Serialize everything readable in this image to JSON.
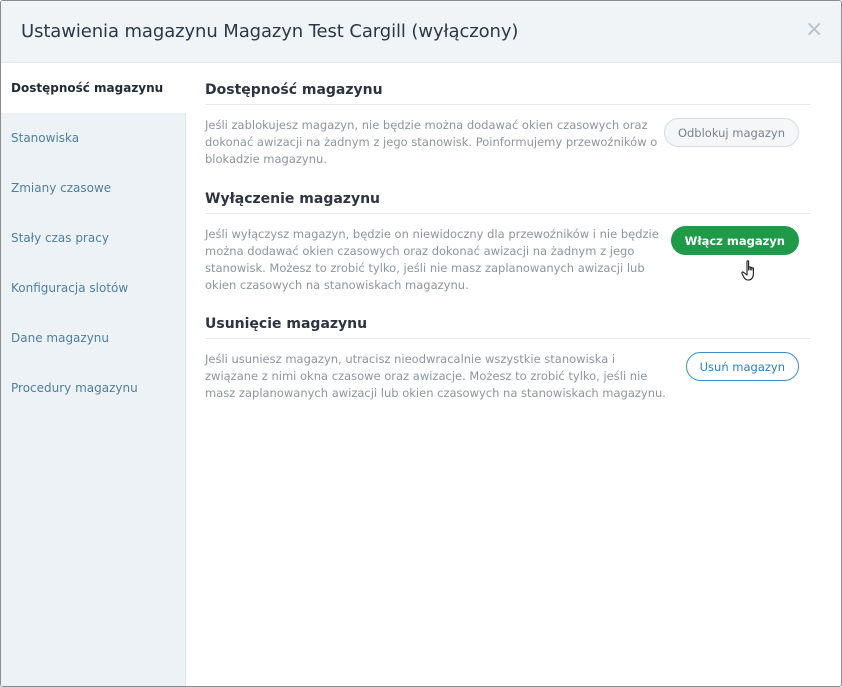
{
  "header": {
    "title": "Ustawienia magazynu Magazyn Test Cargill (wyłączony)",
    "close_glyph": "×"
  },
  "sidebar": {
    "items": [
      {
        "label": "Dostępność magazynu",
        "active": true
      },
      {
        "label": "Stanowiska"
      },
      {
        "label": "Zmiany czasowe"
      },
      {
        "label": "Stały czas pracy"
      },
      {
        "label": "Konfiguracja slotów"
      },
      {
        "label": "Dane magazynu"
      },
      {
        "label": "Procedury magazynu"
      }
    ]
  },
  "sections": {
    "availability": {
      "title": "Dostępność magazynu",
      "text": "Jeśli zablokujesz magazyn, nie będzie można dodawać okien czasowych oraz dokonać awizacji na żadnym z jego stanowisk. Poinformujemy przewoźników o blokadzie magazynu.",
      "button": "Odblokuj magazyn"
    },
    "disable": {
      "title": "Wyłączenie magazynu",
      "text": "Jeśli wyłączysz magazyn, będzie on niewidoczny dla przewoźników i nie będzie można dodawać okien czasowych oraz dokonać awizacji na żadnym z jego stanowisk. Możesz to zrobić tylko, jeśli nie masz zaplanowanych awizacji lub okien czasowych na stanowiskach magazynu.",
      "button": "Włącz magazyn"
    },
    "delete": {
      "title": "Usunięcie magazynu",
      "text": "Jeśli usuniesz magazyn, utracisz nieodwracalnie wszystkie stanowiska i związane z nimi okna czasowe oraz awizacje. Możesz to zrobić tylko, jeśli nie masz zaplanowanych awizacji lub okien czasowych na stanowiskach magazynu.",
      "button": "Usuń magazyn"
    }
  },
  "colors": {
    "accent_green": "#1e9a48",
    "accent_blue": "#2d7ec2"
  }
}
